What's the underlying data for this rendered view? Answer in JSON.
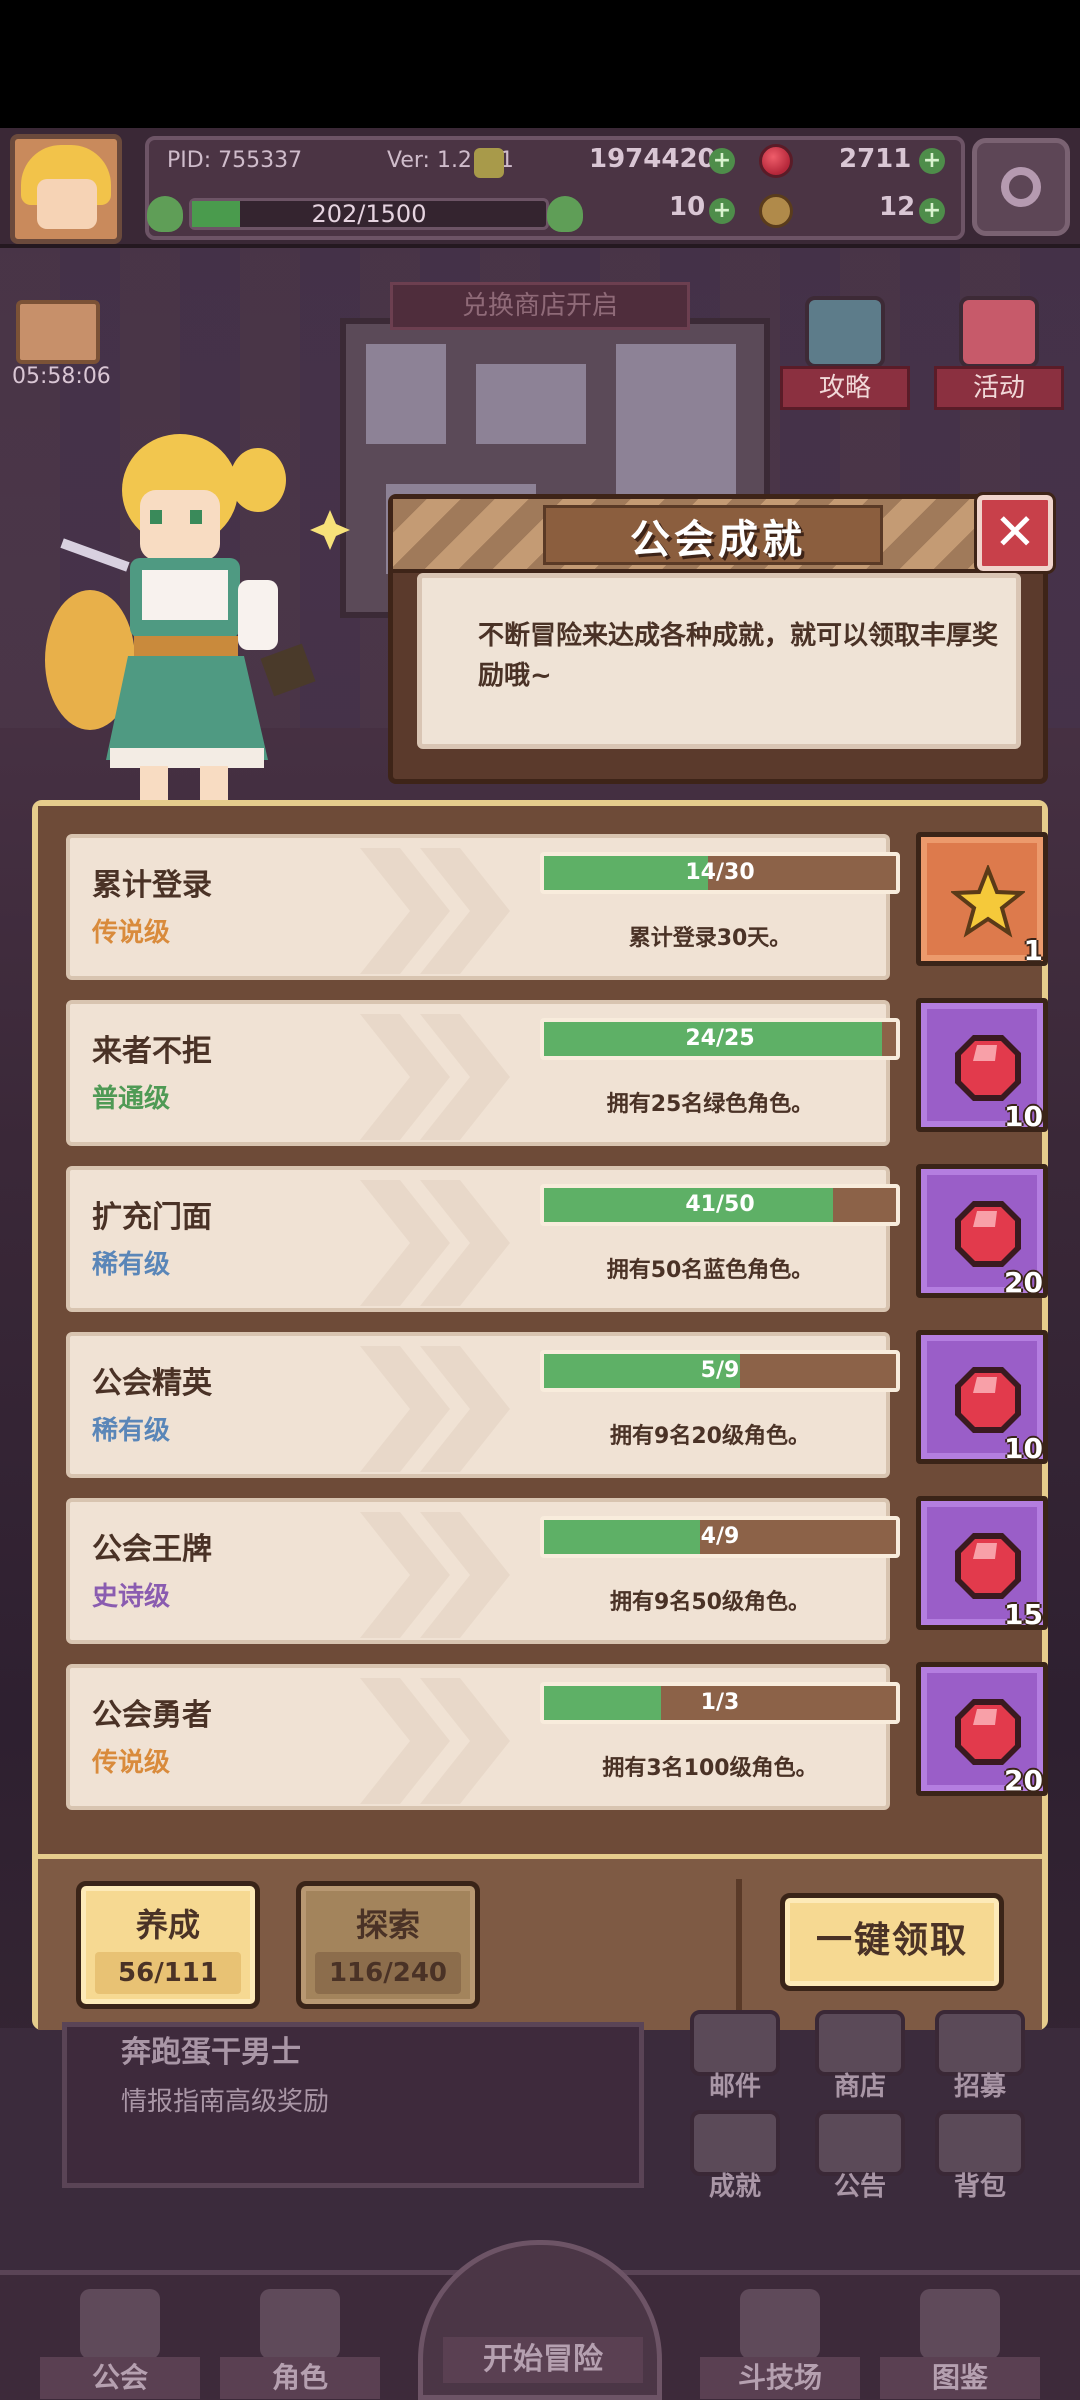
{
  "hud": {
    "pid": "PID: 755337",
    "version": "Ver: 1.2.2.1",
    "gold": "1974420",
    "gems": "2711",
    "stamina": "202/1500",
    "stamina_fraction": 0.1347,
    "clover": "10",
    "keys": "12"
  },
  "event": {
    "timer": "05:58:06"
  },
  "shop_banner": "兑换商店开启",
  "side_buttons": {
    "guide": "攻略",
    "activity": "活动"
  },
  "panel": {
    "title": "公会成就",
    "description": "不断冒险来达成各种成就，就可以领取丰厚奖励哦~"
  },
  "achievements": [
    {
      "name": "累计登录",
      "rank": "传说级",
      "rank_color": "#d98b3c",
      "progress": "14/30",
      "fraction": 0.4667,
      "desc": "累计登录30天。",
      "reward": "star",
      "reward_count": "1"
    },
    {
      "name": "来者不拒",
      "rank": "普通级",
      "rank_color": "#4f9a55",
      "progress": "24/25",
      "fraction": 0.96,
      "desc": "拥有25名绿色角色。",
      "reward": "gem",
      "reward_count": "10"
    },
    {
      "name": "扩充门面",
      "rank": "稀有级",
      "rank_color": "#5a86b8",
      "progress": "41/50",
      "fraction": 0.82,
      "desc": "拥有50名蓝色角色。",
      "reward": "gem",
      "reward_count": "20"
    },
    {
      "name": "公会精英",
      "rank": "稀有级",
      "rank_color": "#5a86b8",
      "progress": "5/9",
      "fraction": 0.5556,
      "desc": "拥有9名20级角色。",
      "reward": "gem",
      "reward_count": "10"
    },
    {
      "name": "公会王牌",
      "rank": "史诗级",
      "rank_color": "#8a5cb0",
      "progress": "4/9",
      "fraction": 0.4444,
      "desc": "拥有9名50级角色。",
      "reward": "gem",
      "reward_count": "15"
    },
    {
      "name": "公会勇者",
      "rank": "传说级",
      "rank_color": "#d98b3c",
      "progress": "1/3",
      "fraction": 0.3333,
      "desc": "拥有3名100级角色。",
      "reward": "gem",
      "reward_count": "20"
    }
  ],
  "tabs": {
    "nurture": {
      "label": "养成",
      "count": "56/111"
    },
    "explore": {
      "label": "探索",
      "count": "116/240"
    }
  },
  "claim_all": "一键领取",
  "lower": {
    "banner_title": "奔跑蛋干男士",
    "banner_sub": "情报指南高级奖励",
    "mail": "邮件",
    "shop": "商店",
    "recruit": "招募",
    "achievement": "成就",
    "notice": "公告",
    "bag": "背包"
  },
  "nav": {
    "guild": "公会",
    "character": "角色",
    "adventure": "开始冒险",
    "arena": "斗技场",
    "codex": "图鉴"
  }
}
